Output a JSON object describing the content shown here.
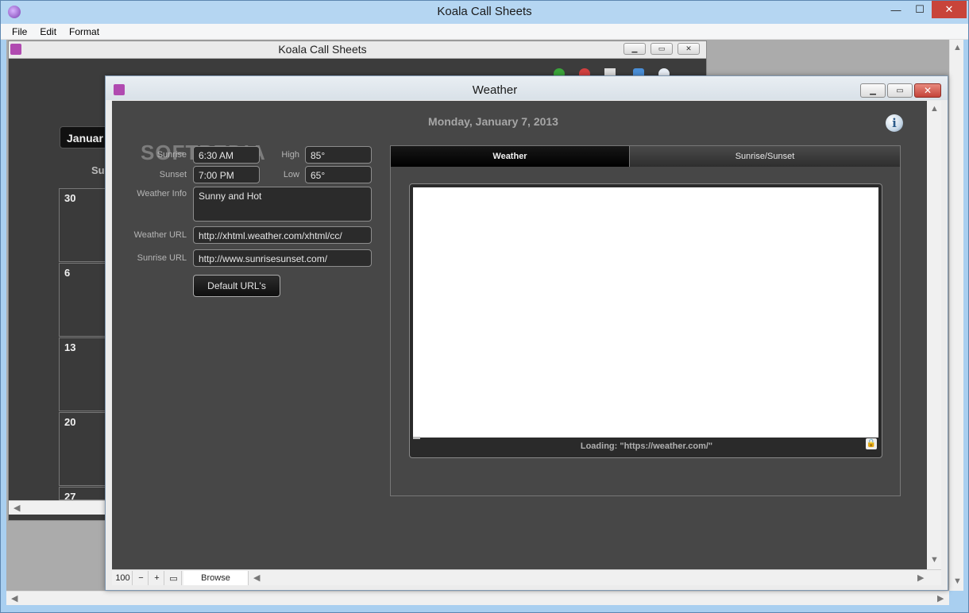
{
  "outer_window": {
    "title": "Koala Call Sheets",
    "menu": [
      "File",
      "Edit",
      "Format"
    ],
    "minimize_glyph": "—",
    "maximize_glyph": "☐",
    "close_glyph": "✕"
  },
  "inner_window": {
    "title": "Koala Call Sheets",
    "month_button": "Januar",
    "day_header": "Su",
    "calendar_days": [
      "30",
      "6",
      "13",
      "20",
      "27"
    ]
  },
  "weather_window": {
    "title": "Weather",
    "date_header": "Monday, January 7, 2013",
    "info_glyph": "i",
    "watermark": "SOFTPEDIA",
    "fields": {
      "sunrise_label": "Sunrise",
      "sunrise_value": "6:30 AM",
      "sunset_label": "Sunset",
      "sunset_value": "7:00 PM",
      "high_label": "High",
      "high_value": "85°",
      "low_label": "Low",
      "low_value": "65°",
      "weather_info_label": "Weather Info",
      "weather_info_value": "Sunny and Hot",
      "weather_url_label": "Weather URL",
      "weather_url_value": "http://xhtml.weather.com/xhtml/cc/",
      "sunrise_url_label": "Sunrise URL",
      "sunrise_url_value": "http://www.sunrisesunset.com/"
    },
    "default_urls_button": "Default URL's",
    "tabs": [
      {
        "label": "Weather",
        "active": true
      },
      {
        "label": "Sunrise/Sunset",
        "active": false
      }
    ],
    "loading_text": "Loading: \"https://weather.com/\"",
    "status_bar": {
      "zoom": "100",
      "zoom_out": "−",
      "zoom_in": "+",
      "mode": "Browse"
    }
  },
  "colors": {
    "panel_bg": "#474747",
    "field_bg": "#2b2b2b",
    "title_bar": "#b5d6f2",
    "close_red": "#c8443a"
  }
}
